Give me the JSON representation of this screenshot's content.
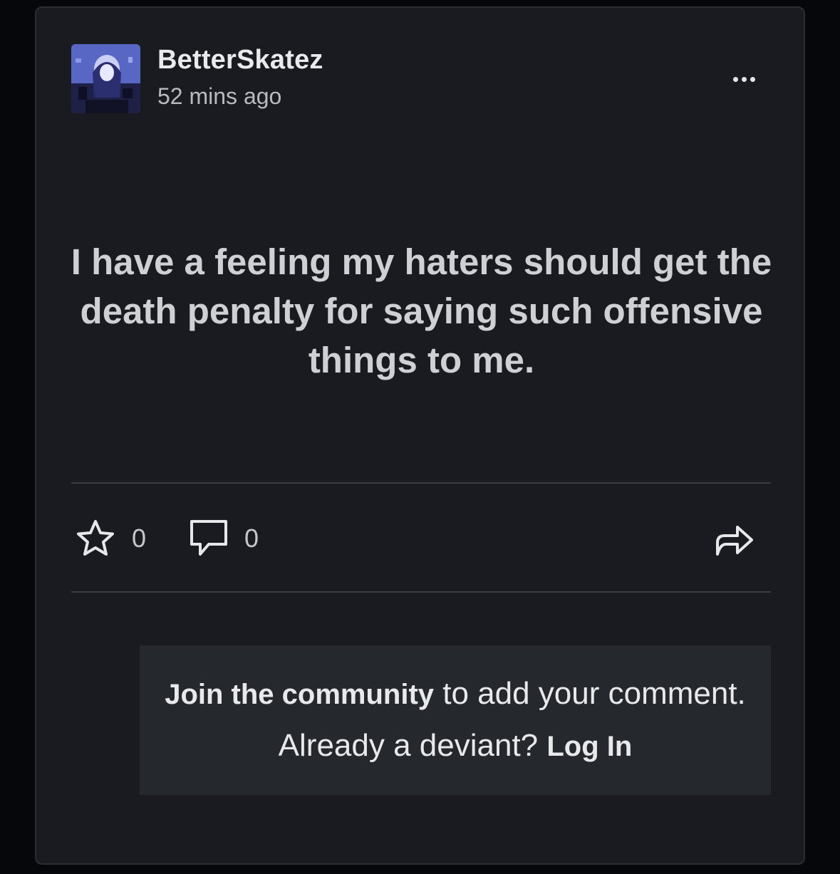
{
  "post": {
    "author": "BetterSkatez",
    "time": "52 mins ago",
    "text": "I have a feeling my haters should get the death penalty for saying such offensive things to me."
  },
  "actions": {
    "favourites_count": "0",
    "comments_count": "0"
  },
  "icons": [
    "avatar",
    "more-icon",
    "star-icon",
    "comment-icon",
    "share-icon"
  ],
  "join_prompt": {
    "join_link": "Join the community",
    "middle_text": " to add your comment. Already a deviant? ",
    "login_link": "Log In"
  },
  "colors": {
    "background": "#06070b",
    "card": "#191b20",
    "join_box": "#25282d"
  }
}
